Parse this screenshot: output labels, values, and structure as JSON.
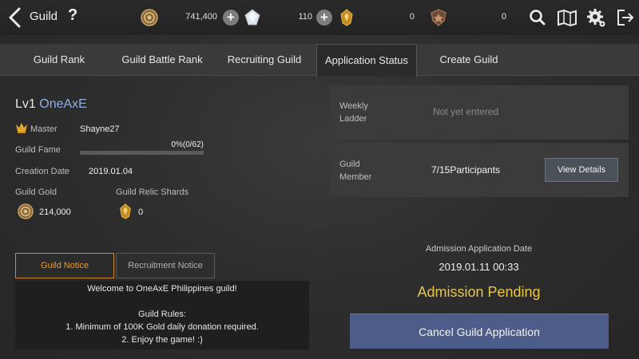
{
  "header": {
    "title": "Guild",
    "help_label": "?"
  },
  "currencies": [
    {
      "icon": "gold-coin-icon",
      "value": "741,400"
    },
    {
      "icon": "diamond-icon",
      "value": "110"
    },
    {
      "icon": "relic-shard-icon",
      "value": "0"
    },
    {
      "icon": "shield-emblem-icon",
      "value": "0"
    }
  ],
  "tabs": [
    {
      "label": "Guild Rank",
      "active": false
    },
    {
      "label": "Guild Battle Rank",
      "active": false
    },
    {
      "label": "Recruiting Guild",
      "active": false
    },
    {
      "label": "Application Status",
      "active": true
    },
    {
      "label": "Create Guild",
      "active": false
    }
  ],
  "guild": {
    "level": "Lv1",
    "name": "OneAxE",
    "master_label": "Master",
    "master": "Shayne27",
    "fame_label": "Guild Fame",
    "fame_text": "0%(0/62)",
    "fame_progress": 0,
    "creation_label": "Creation Date",
    "creation_date": "2019.01.04",
    "gold_label": "Guild Gold",
    "gold": "214,000",
    "relic_label": "Guild Relic Shards",
    "relic": "0"
  },
  "notice": {
    "tab_guild": "Guild Notice",
    "tab_recruit": "Recruitment Notice",
    "lines": [
      "Welcome to OneAxE Philippines guild!",
      "",
      "Guild Rules:",
      "1. Minimum of 100K Gold daily donation required.",
      "2. Enjoy the game! :)"
    ]
  },
  "status": {
    "ladder_label_1": "Weekly",
    "ladder_label_2": "Ladder",
    "ladder_value": "Not yet entered",
    "member_label_1": "Guild",
    "member_label_2": "Member",
    "member_value": "7/15Participants",
    "view_details": "View Details",
    "date_label": "Admission Application Date",
    "date_value": "2019.01.11 00:33",
    "pending": "Admission Pending",
    "cancel": "Cancel Guild Application"
  },
  "colors": {
    "guild_name": "#8fb0e6",
    "pending": "#e8c64a",
    "notice_active": "#e39b33",
    "cancel_button": "#4d5c88"
  }
}
